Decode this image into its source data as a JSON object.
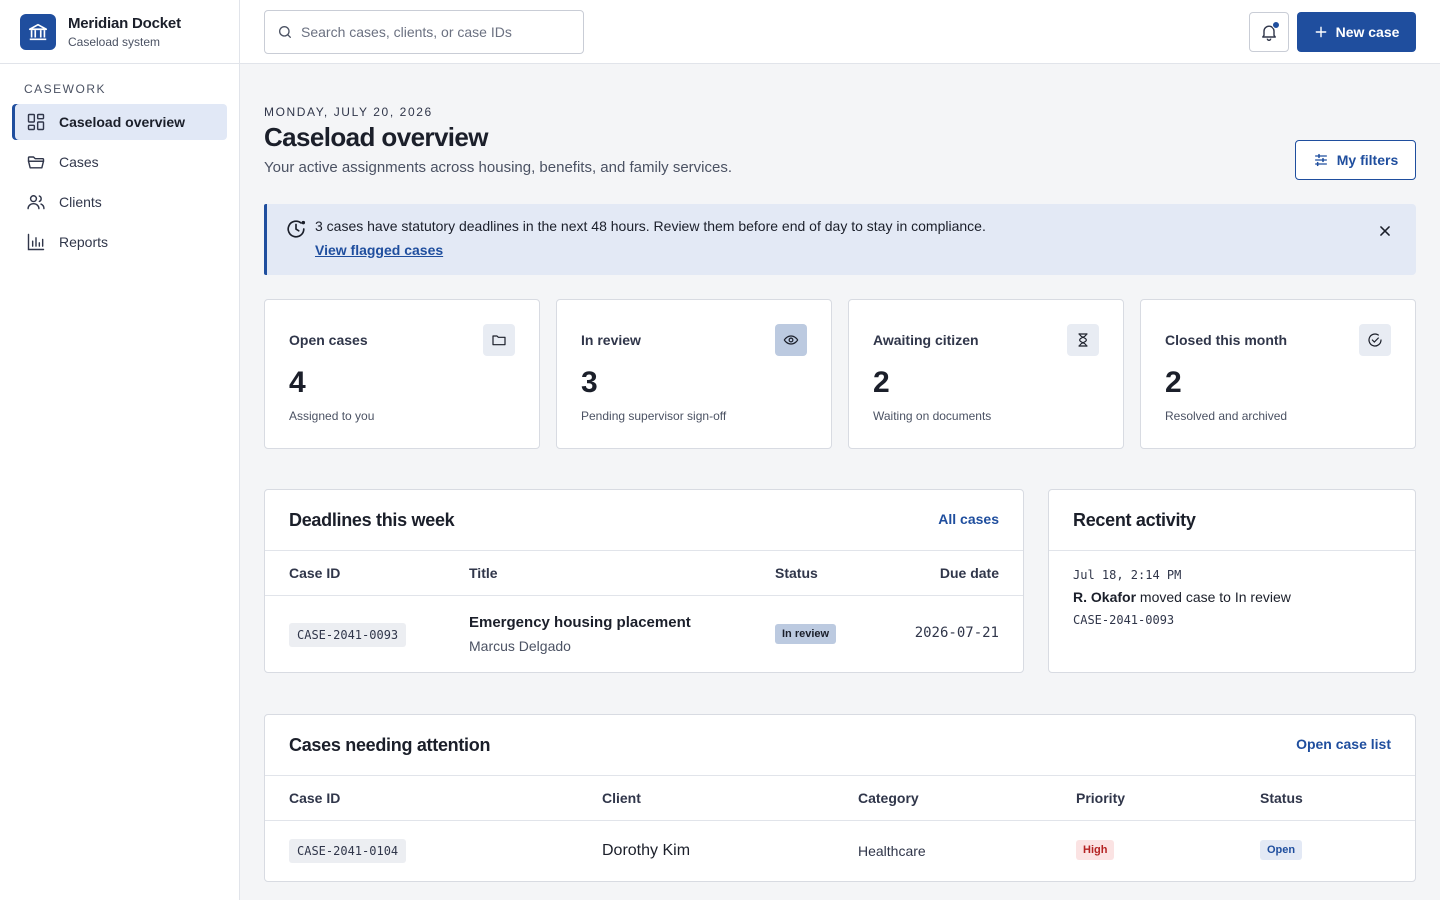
{
  "app": {
    "name": "Meridian Docket",
    "subtitle": "Caseload system"
  },
  "sidebar": {
    "section": "CASEWORK",
    "items": [
      {
        "label": "Caseload overview",
        "icon": "grid-icon",
        "active": true
      },
      {
        "label": "Cases",
        "icon": "folder-icon"
      },
      {
        "label": "Clients",
        "icon": "users-icon"
      },
      {
        "label": "Reports",
        "icon": "bar-chart-icon"
      }
    ]
  },
  "topbar": {
    "search_placeholder": "Search cases, clients, or case IDs",
    "new_case_label": "New case"
  },
  "header": {
    "date": "MONDAY, JULY 20, 2026",
    "title": "Caseload overview",
    "subtitle": "Your active assignments across housing, benefits, and family services.",
    "filters_label": "My filters"
  },
  "alert": {
    "message": "3 cases have statutory deadlines in the next 48 hours. Review them before end of day to stay in compliance.",
    "link": "View flagged cases"
  },
  "stats": [
    {
      "label": "Open cases",
      "value": "4",
      "desc": "Assigned to you",
      "icon": "folder-icon"
    },
    {
      "label": "In review",
      "value": "3",
      "desc": "Pending supervisor sign-off",
      "icon": "eye-icon"
    },
    {
      "label": "Awaiting citizen",
      "value": "2",
      "desc": "Waiting on documents",
      "icon": "hourglass-icon"
    },
    {
      "label": "Closed this month",
      "value": "2",
      "desc": "Resolved and archived",
      "icon": "check-circle-icon"
    }
  ],
  "deadlines": {
    "title": "Deadlines this week",
    "link": "All cases",
    "columns": [
      "Case ID",
      "Title",
      "Status",
      "Due date"
    ],
    "rows": [
      {
        "case_id": "CASE-2041-0093",
        "title": "Emergency housing placement",
        "client": "Marcus Delgado",
        "status": "In review",
        "due": "2026-07-21"
      }
    ]
  },
  "activity": {
    "title": "Recent activity",
    "items": [
      {
        "time": "Jul 18, 2:14 PM",
        "actor": "R. Okafor",
        "action": "moved case to In review",
        "case_id": "CASE-2041-0093"
      }
    ]
  },
  "attention": {
    "title": "Cases needing attention",
    "link": "Open case list",
    "columns": [
      "Case ID",
      "Client",
      "Category",
      "Priority",
      "Status"
    ],
    "rows": [
      {
        "case_id": "CASE-2041-0104",
        "client": "Dorothy Kim",
        "category": "Healthcare",
        "priority": "High",
        "status": "Open"
      }
    ]
  },
  "colors": {
    "accent": "#1f4e9e",
    "alert_bg": "#e3e9f5",
    "priority_high": "#b42323"
  }
}
